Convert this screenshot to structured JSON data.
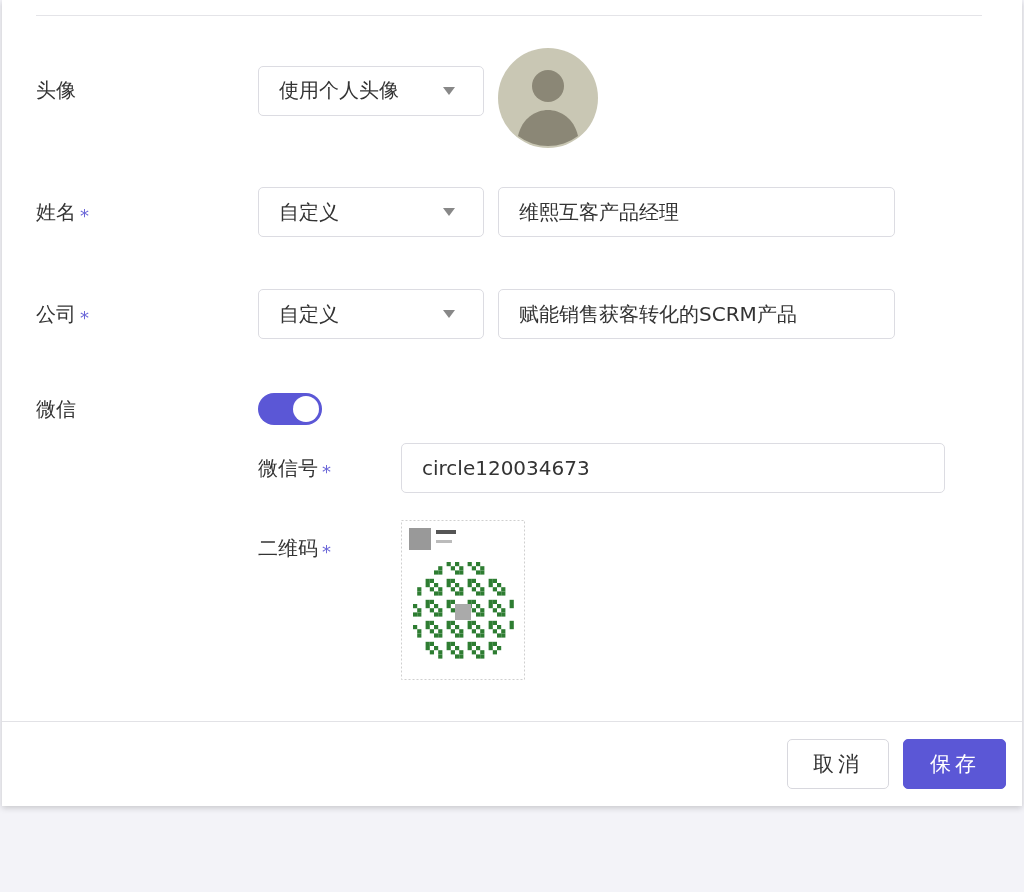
{
  "form": {
    "rows": [
      {
        "kind": "avatar",
        "label": "头像",
        "select": "使用个人头像"
      },
      {
        "kind": "text",
        "label": "姓名",
        "mark": "*",
        "select": "自定义",
        "value": "维熙互客产品经理"
      },
      {
        "kind": "text",
        "label": "公司",
        "mark": "*",
        "select": "自定义",
        "value": "赋能销售获客转化的SCRM产品"
      }
    ]
  },
  "wechat": {
    "label": "微信",
    "on": true,
    "fields": [
      {
        "kind": "text",
        "label": "微信号",
        "mark": "*",
        "value": "circle120034673"
      },
      {
        "kind": "qr",
        "label": "二维码",
        "mark": "*"
      }
    ]
  },
  "buttons": [
    {
      "kind": "secondary",
      "label": "取消"
    },
    {
      "kind": "primary",
      "label": "保存"
    }
  ]
}
